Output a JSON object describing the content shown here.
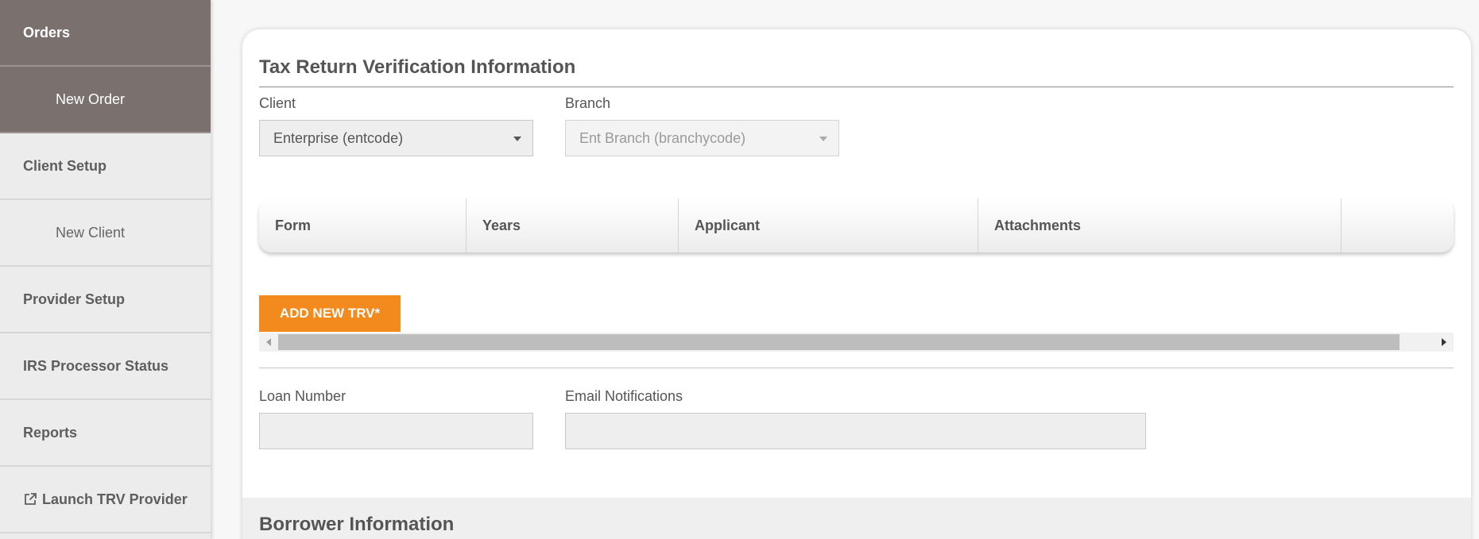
{
  "sidebar": {
    "items": [
      {
        "label": "Orders"
      },
      {
        "label": "New Order"
      },
      {
        "label": "Client Setup"
      },
      {
        "label": "New Client"
      },
      {
        "label": "Provider Setup"
      },
      {
        "label": "IRS Processor Status"
      },
      {
        "label": "Reports"
      },
      {
        "label": "Launch TRV Provider",
        "icon": "external-link-icon"
      }
    ]
  },
  "trv_section": {
    "title": "Tax Return Verification Information",
    "client": {
      "label": "Client",
      "value": "Enterprise (entcode)"
    },
    "branch": {
      "label": "Branch",
      "value": "Ent Branch (branchycode)"
    },
    "grid": {
      "columns": [
        "Form",
        "Years",
        "Applicant",
        "Attachments",
        ""
      ]
    },
    "add_button": "ADD NEW TRV*",
    "loan_number": {
      "label": "Loan Number",
      "value": ""
    },
    "email_notifications": {
      "label": "Email Notifications",
      "value": ""
    }
  },
  "borrower_section": {
    "title": "Borrower Information"
  },
  "colors": {
    "active_nav": "#7a716f",
    "accent_button": "#f28a1e"
  }
}
